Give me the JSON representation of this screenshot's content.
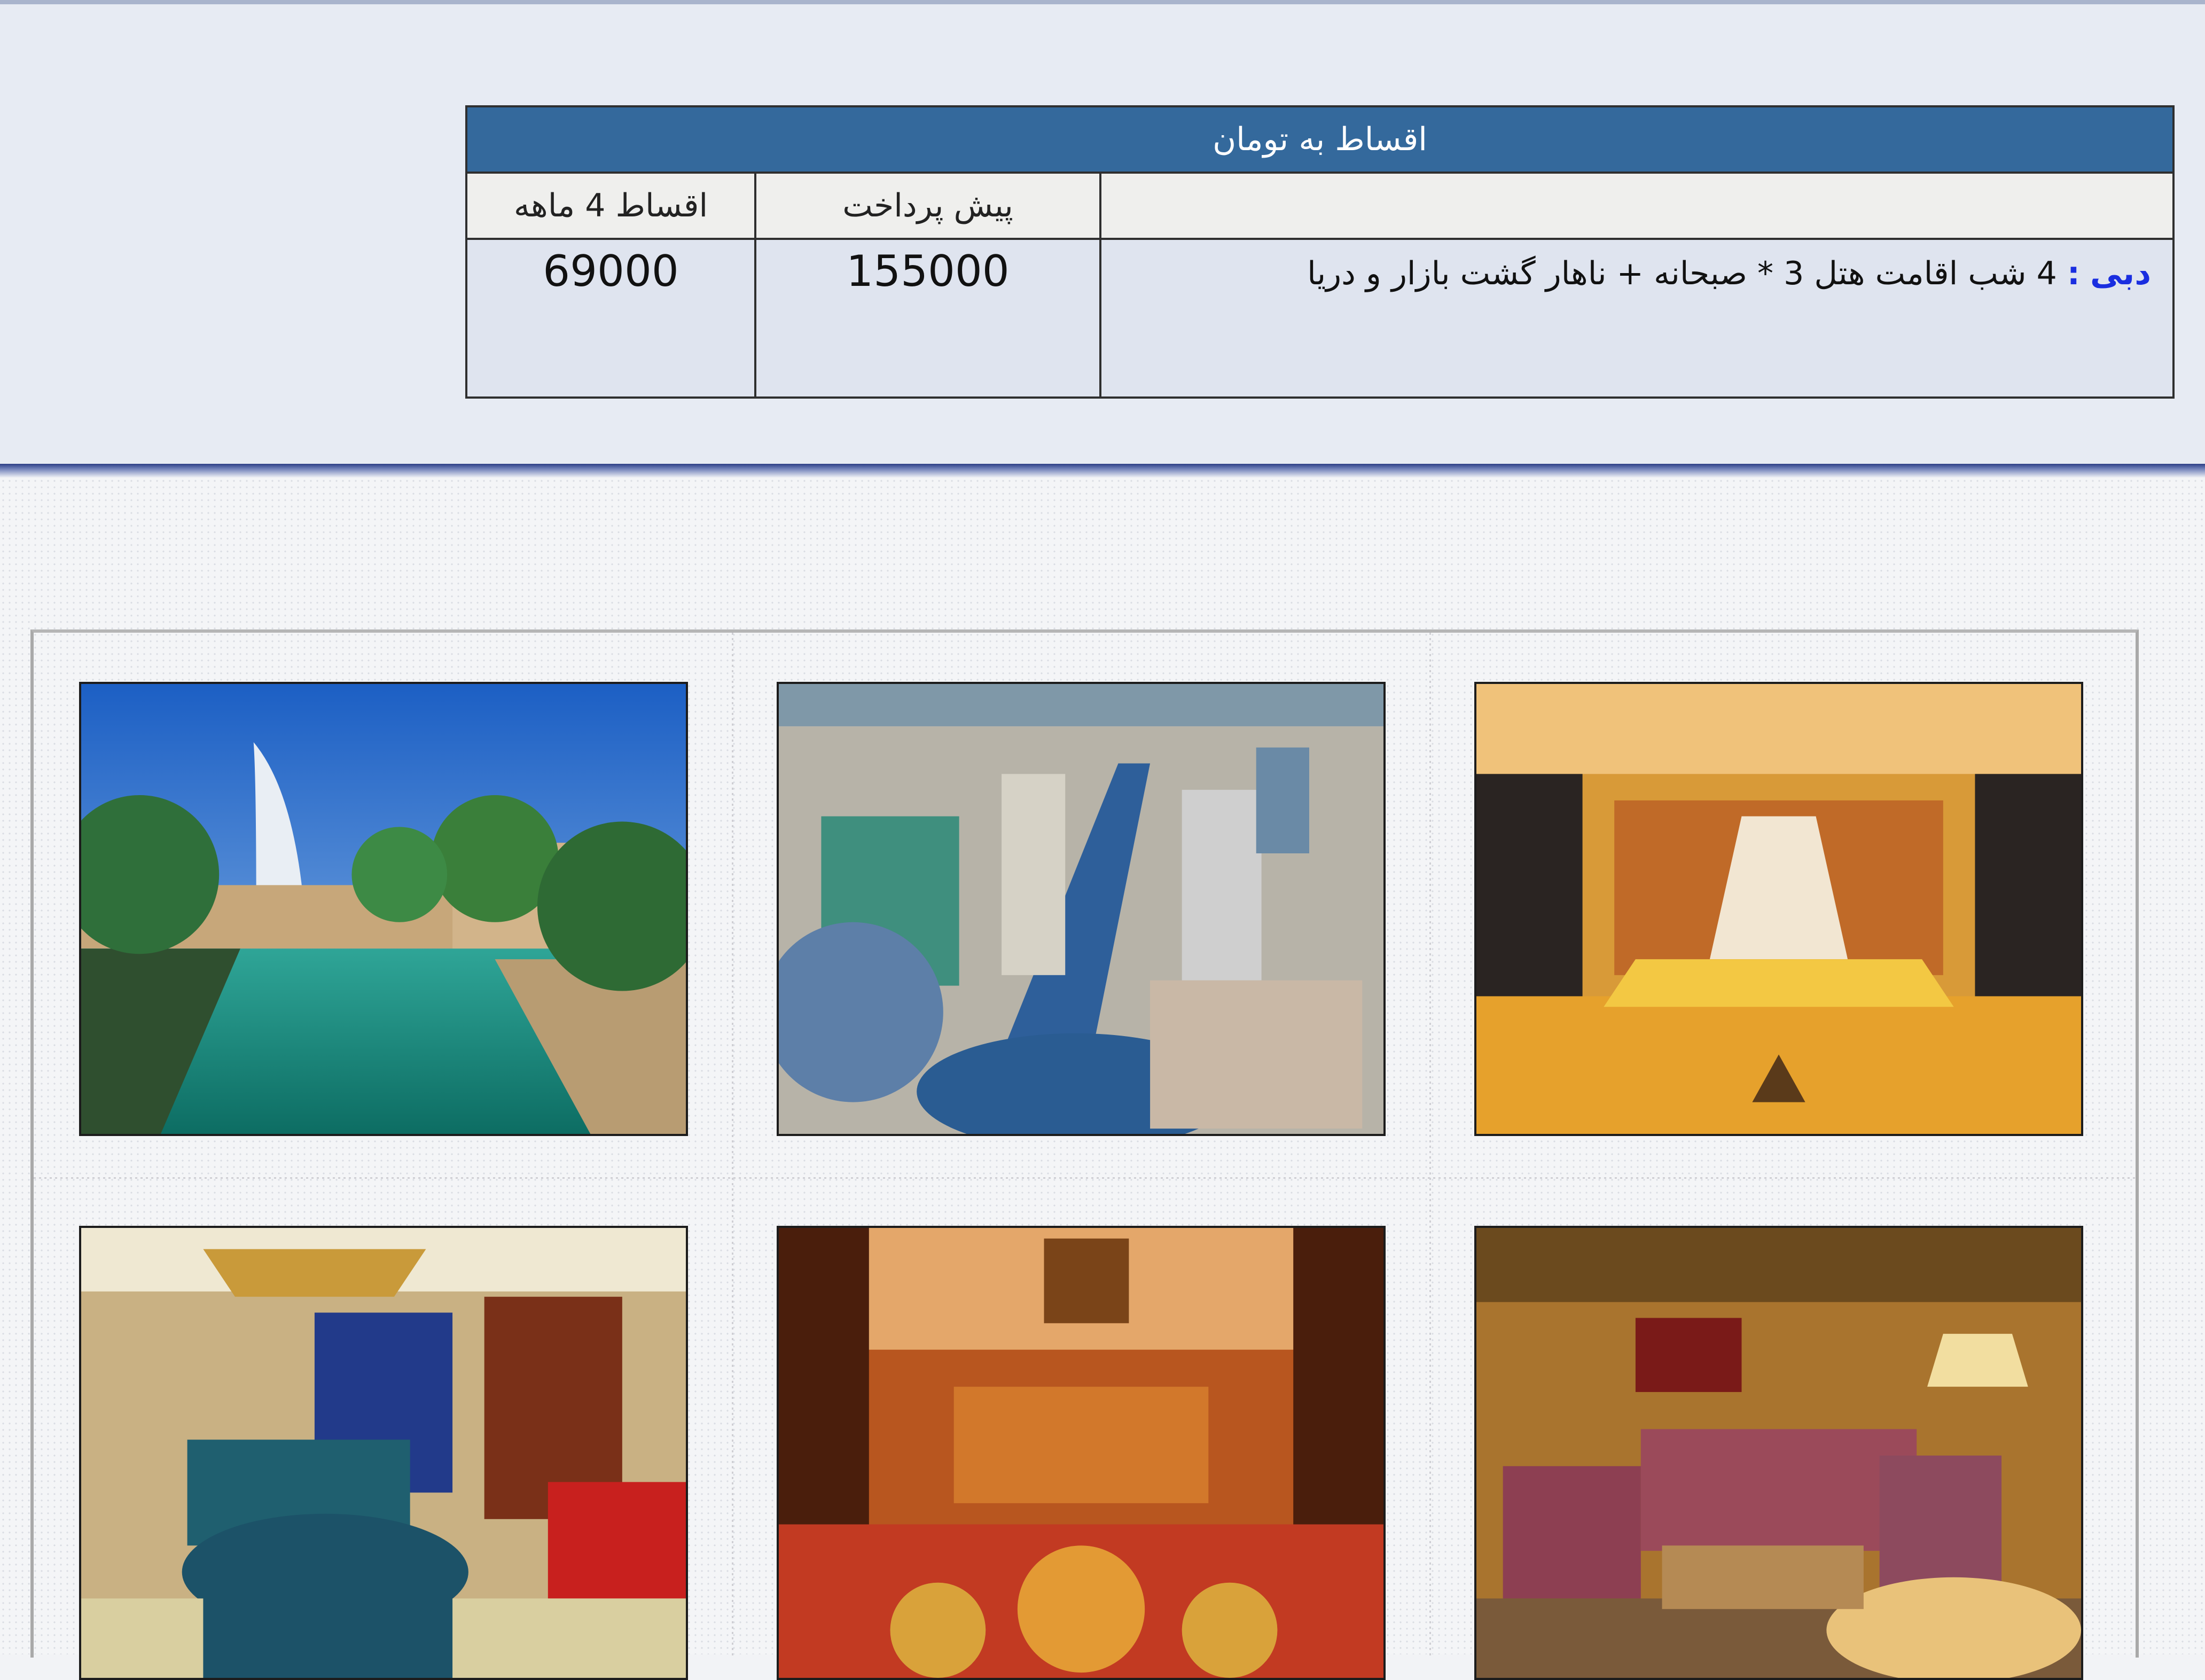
{
  "installments": {
    "title": "اقساط به تومان",
    "headers": {
      "prepayment": "پیش پرداخت",
      "installments_4_months": "اقساط 4 ماهه"
    },
    "package": {
      "destination": "دبی",
      "separator": ":",
      "description": "4 شب اقامت هتل 3 *   صبحانه  + ناهار  گشت بازار و دریا",
      "prepayment": "155000",
      "installment": "69000"
    }
  },
  "gallery": {
    "photos": [
      {
        "icon": "canal-palace-photo"
      },
      {
        "icon": "city-canal-aerial-photo"
      },
      {
        "icon": "hotel-lobby-photo"
      },
      {
        "icon": "bedroom-suite-photo"
      },
      {
        "icon": "dining-hall-photo"
      },
      {
        "icon": "lounge-room-photo"
      }
    ]
  },
  "colors": {
    "header_blue": "#34699c",
    "band_background": "#e7ebf3",
    "destination_link": "#1a2ee0"
  }
}
